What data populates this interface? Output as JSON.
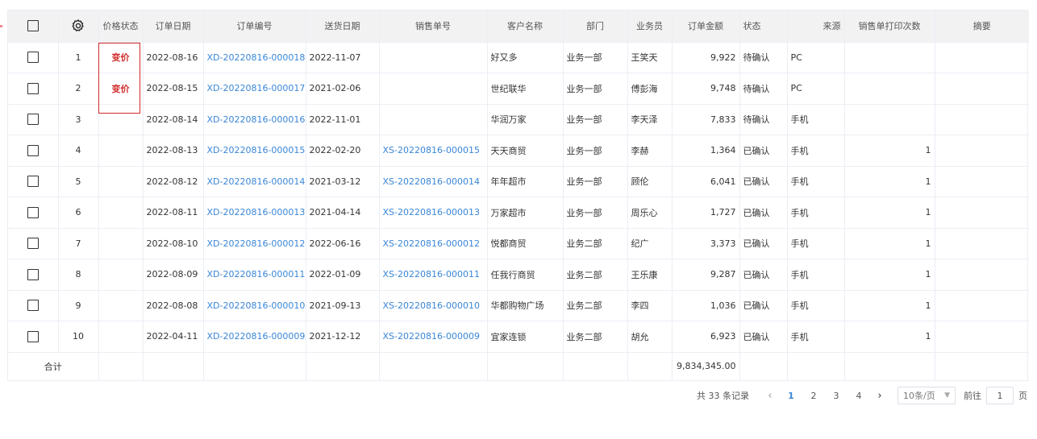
{
  "columns": {
    "price_status": "价格状态",
    "order_date": "订单日期",
    "order_no": "订单编号",
    "delivery_date": "送货日期",
    "sales_no": "销售单号",
    "customer": "客户名称",
    "dept": "部门",
    "salesman": "业务员",
    "amount": "订单金额",
    "status": "状态",
    "source": "来源",
    "print_count": "销售单打印次数",
    "summary": "摘要"
  },
  "rows": [
    {
      "idx": "1",
      "price_status": "变价",
      "order_date": "2022-08-16",
      "order_no": "XD-20220816-000018",
      "delivery_date": "2022-11-07",
      "sales_no": "",
      "customer": "好又多",
      "dept": "业务一部",
      "salesman": "王笑天",
      "amount": "9,922",
      "status": "待确认",
      "source": "PC",
      "print_count": "",
      "summary": ""
    },
    {
      "idx": "2",
      "price_status": "变价",
      "order_date": "2022-08-15",
      "order_no": "XD-20220816-000017",
      "delivery_date": "2021-02-06",
      "sales_no": "",
      "customer": "世纪联华",
      "dept": "业务一部",
      "salesman": "傅彭海",
      "amount": "9,748",
      "status": "待确认",
      "source": "PC",
      "print_count": "",
      "summary": ""
    },
    {
      "idx": "3",
      "price_status": "",
      "order_date": "2022-08-14",
      "order_no": "XD-20220816-000016",
      "delivery_date": "2022-11-01",
      "sales_no": "",
      "customer": "华润万家",
      "dept": "业务一部",
      "salesman": "李天泽",
      "amount": "7,833",
      "status": "待确认",
      "source": "手机",
      "print_count": "",
      "summary": ""
    },
    {
      "idx": "4",
      "price_status": "",
      "order_date": "2022-08-13",
      "order_no": "XD-20220816-000015",
      "delivery_date": "2022-02-20",
      "sales_no": "XS-20220816-000015",
      "customer": "天天商贸",
      "dept": "业务一部",
      "salesman": "李赫",
      "amount": "1,364",
      "status": "已确认",
      "source": "手机",
      "print_count": "1",
      "summary": ""
    },
    {
      "idx": "5",
      "price_status": "",
      "order_date": "2022-08-12",
      "order_no": "XD-20220816-000014",
      "delivery_date": "2021-03-12",
      "sales_no": "XS-20220816-000014",
      "customer": "年年超市",
      "dept": "业务一部",
      "salesman": "顾伦",
      "amount": "6,041",
      "status": "已确认",
      "source": "手机",
      "print_count": "1",
      "summary": ""
    },
    {
      "idx": "6",
      "price_status": "",
      "order_date": "2022-08-11",
      "order_no": "XD-20220816-000013",
      "delivery_date": "2021-04-14",
      "sales_no": "XS-20220816-000013",
      "customer": "万家超市",
      "dept": "业务一部",
      "salesman": "周乐心",
      "amount": "1,727",
      "status": "已确认",
      "source": "手机",
      "print_count": "1",
      "summary": ""
    },
    {
      "idx": "7",
      "price_status": "",
      "order_date": "2022-08-10",
      "order_no": "XD-20220816-000012",
      "delivery_date": "2022-06-16",
      "sales_no": "XS-20220816-000012",
      "customer": "悦都商贸",
      "dept": "业务二部",
      "salesman": "纪广",
      "amount": "3,373",
      "status": "已确认",
      "source": "手机",
      "print_count": "1",
      "summary": ""
    },
    {
      "idx": "8",
      "price_status": "",
      "order_date": "2022-08-09",
      "order_no": "XD-20220816-000011",
      "delivery_date": "2022-01-09",
      "sales_no": "XS-20220816-000011",
      "customer": "任我行商贸",
      "dept": "业务二部",
      "salesman": "王乐康",
      "amount": "9,287",
      "status": "已确认",
      "source": "手机",
      "print_count": "1",
      "summary": ""
    },
    {
      "idx": "9",
      "price_status": "",
      "order_date": "2022-08-08",
      "order_no": "XD-20220816-000010",
      "delivery_date": "2021-09-13",
      "sales_no": "XS-20220816-000010",
      "customer": "华都购物广场",
      "dept": "业务二部",
      "salesman": "李四",
      "amount": "1,036",
      "status": "已确认",
      "source": "手机",
      "print_count": "1",
      "summary": ""
    },
    {
      "idx": "10",
      "price_status": "",
      "order_date": "2022-04-11",
      "order_no": "XD-20220816-000009",
      "delivery_date": "2021-12-12",
      "sales_no": "XS-20220816-000009",
      "customer": "宜家连锁",
      "dept": "业务二部",
      "salesman": "胡允",
      "amount": "6,923",
      "status": "已确认",
      "source": "手机",
      "print_count": "1",
      "summary": ""
    }
  ],
  "footer": {
    "label": "合计",
    "total_amount": "9,834,345.00"
  },
  "pagination": {
    "total_text": "共 33 条记录",
    "prev": "‹",
    "next": "›",
    "pages": [
      "1",
      "2",
      "3",
      "4"
    ],
    "current": "1",
    "page_size": "10条/页",
    "jump_prefix": "前往",
    "jump_value": "1",
    "jump_suffix": "页"
  },
  "colors": {
    "link": "#3a86d6",
    "price_tag": "#d02b2b",
    "header_bg": "#f2f2f2"
  },
  "icons": {
    "settings": "gear-icon",
    "select": "checkbox"
  }
}
